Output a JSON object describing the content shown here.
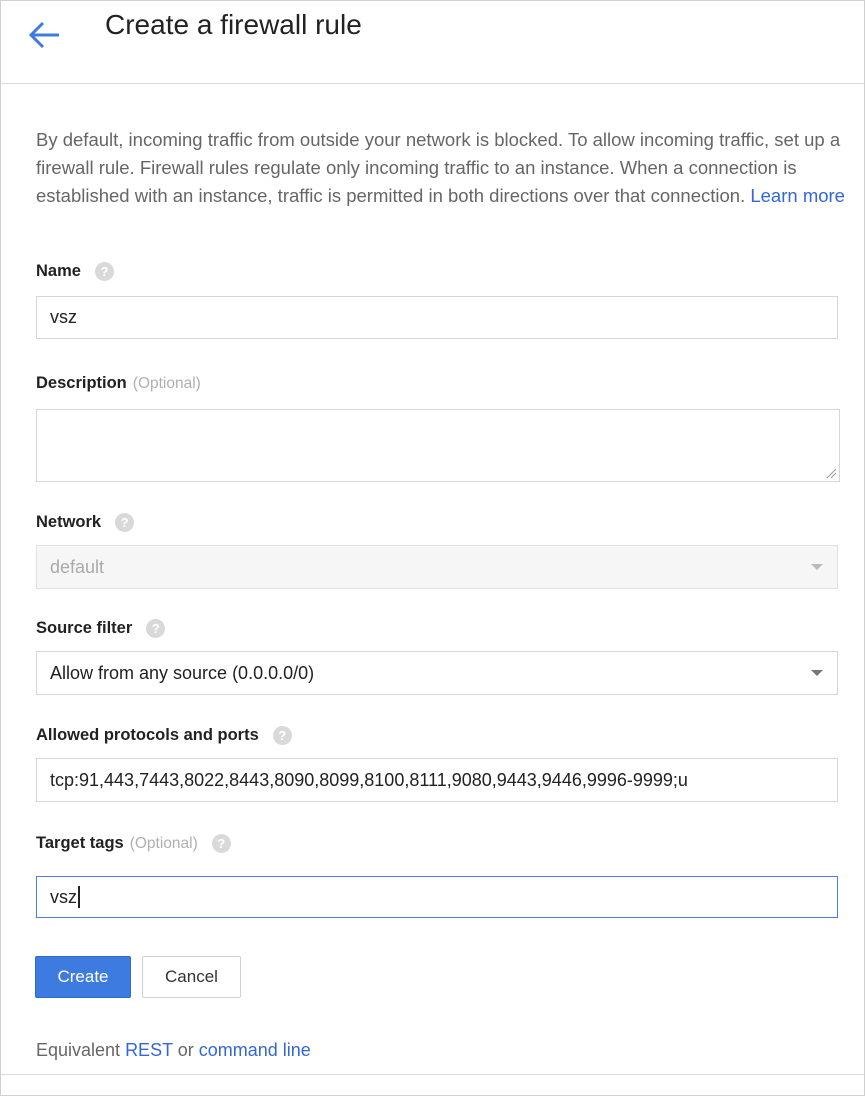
{
  "header": {
    "back_icon": "arrow-back-icon",
    "title": "Create a firewall rule"
  },
  "intro": {
    "text": "By default, incoming traffic from outside your network is blocked. To allow incoming traffic, set up a firewall rule. Firewall rules regulate only incoming traffic to an instance. When a connection is established with an instance, traffic is permitted in both directions over that connection. ",
    "learn_more": "Learn more"
  },
  "form": {
    "name": {
      "label": "Name",
      "value": "vsz",
      "help_icon": "help-icon"
    },
    "description": {
      "label": "Description",
      "optional": "(Optional)",
      "value": ""
    },
    "network": {
      "label": "Network",
      "value": "default",
      "disabled": true,
      "help_icon": "help-icon"
    },
    "source_filter": {
      "label": "Source filter",
      "value": "Allow from any source (0.0.0.0/0)",
      "help_icon": "help-icon"
    },
    "allowed": {
      "label": "Allowed protocols and ports",
      "value": "tcp:91,443,7443,8022,8443,8090,8099,8100,8111,9080,9443,9446,9996-9999;u",
      "help_icon": "help-icon"
    },
    "target_tags": {
      "label": "Target tags",
      "optional": "(Optional)",
      "value": "vsz",
      "help_icon": "help-icon"
    }
  },
  "buttons": {
    "create": "Create",
    "cancel": "Cancel"
  },
  "footer": {
    "prefix": "Equivalent ",
    "rest": "REST",
    "or": " or ",
    "command_line": "command line"
  },
  "colors": {
    "accent": "#3d7be0",
    "link": "#3367d6",
    "muted_text": "#666666"
  }
}
